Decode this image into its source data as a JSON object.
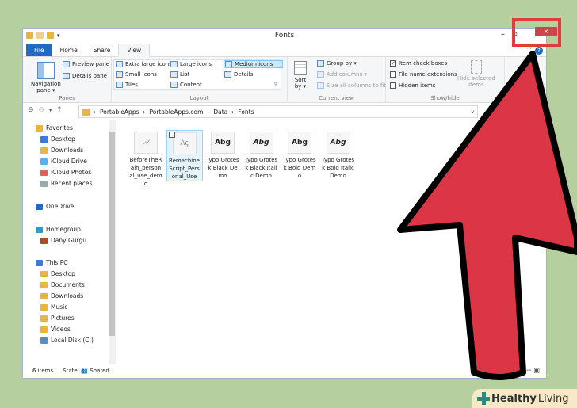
{
  "window": {
    "title": "Fonts",
    "minimize": "–",
    "close": "×"
  },
  "tabs": [
    {
      "label": "File"
    },
    {
      "label": "Home"
    },
    {
      "label": "Share"
    },
    {
      "label": "View"
    }
  ],
  "help": "?",
  "ribbon": {
    "panes": {
      "nav": "Navigation",
      "nav2": "pane ▾",
      "preview": "Preview pane",
      "details": "Details pane",
      "label": "Panes"
    },
    "layout": {
      "items": [
        "Extra large icons",
        "Large icons",
        "Medium icons",
        "Small icons",
        "List",
        "Details",
        "Tiles",
        "Content"
      ],
      "selected": "Medium icons",
      "label": "Layout"
    },
    "current": {
      "sort": "Sort",
      "sort2": "by ▾",
      "group": "Group by ▾",
      "add": "Add columns ▾",
      "size": "Size all columns to fit",
      "label": "Current view"
    },
    "show": {
      "item_cb": "Item check boxes",
      "ext": "File name extensions",
      "hidden": "Hidden items",
      "item_cb_checked": true,
      "ext_checked": false,
      "hidden_checked": false,
      "hide_sel": "Hide selected",
      "hide_sel2": "items",
      "label": "Show/hide"
    }
  },
  "breadcrumb": [
    "PortableApps",
    "PortableApps.com",
    "Data",
    "Fonts"
  ],
  "sidebar": [
    {
      "label": "Favorites",
      "color": "#f2b233"
    },
    {
      "label": "Desktop",
      "color": "#3a7bd5"
    },
    {
      "label": "Downloads",
      "color": "#e8b63c"
    },
    {
      "label": "iCloud Drive",
      "color": "#5ab0f0"
    },
    {
      "label": "iCloud Photos",
      "color": "#e06060"
    },
    {
      "label": "Recent places",
      "color": "#9aa"
    },
    {
      "label": "OneDrive",
      "color": "#1f6bc2"
    },
    {
      "label": "Homegroup",
      "color": "#2a9ad0"
    },
    {
      "label": "Dany Gurgu",
      "color": "#a0522d"
    },
    {
      "label": "This PC",
      "color": "#3a7bd5"
    },
    {
      "label": "Desktop",
      "color": "#e8b63c"
    },
    {
      "label": "Documents",
      "color": "#e8b63c"
    },
    {
      "label": "Downloads",
      "color": "#e8b63c"
    },
    {
      "label": "Music",
      "color": "#e8b63c"
    },
    {
      "label": "Pictures",
      "color": "#e8b63c"
    },
    {
      "label": "Videos",
      "color": "#e8b63c"
    },
    {
      "label": "Local Disk (C:)",
      "color": "#5b8ac2"
    }
  ],
  "files": [
    {
      "name": "BeforeTheRain_personal_use_demo",
      "glyph": "𝒜",
      "selected": false
    },
    {
      "name": "RemachineScript_Personal_Use",
      "glyph": "Aꞔ",
      "selected": true
    },
    {
      "name": "Typo Grotesk Black Demo",
      "glyph": "Abg",
      "selected": false
    },
    {
      "name": "Typo Grotesk Black Italic Demo",
      "glyph": "Abg",
      "selected": false
    },
    {
      "name": "Typo Grotesk Bold Demo",
      "glyph": "Abg",
      "selected": false
    },
    {
      "name": "Typo Grotesk Bold Italic Demo",
      "glyph": "Abg",
      "selected": false
    }
  ],
  "status": {
    "count": "6 items",
    "state": "State: 👥 Shared"
  },
  "logo": {
    "bold": "Healthy",
    "light": " Living"
  },
  "colors": {
    "arrow": "#dc3545",
    "highlight": "#e23b3b",
    "background": "#b6cf9f"
  }
}
